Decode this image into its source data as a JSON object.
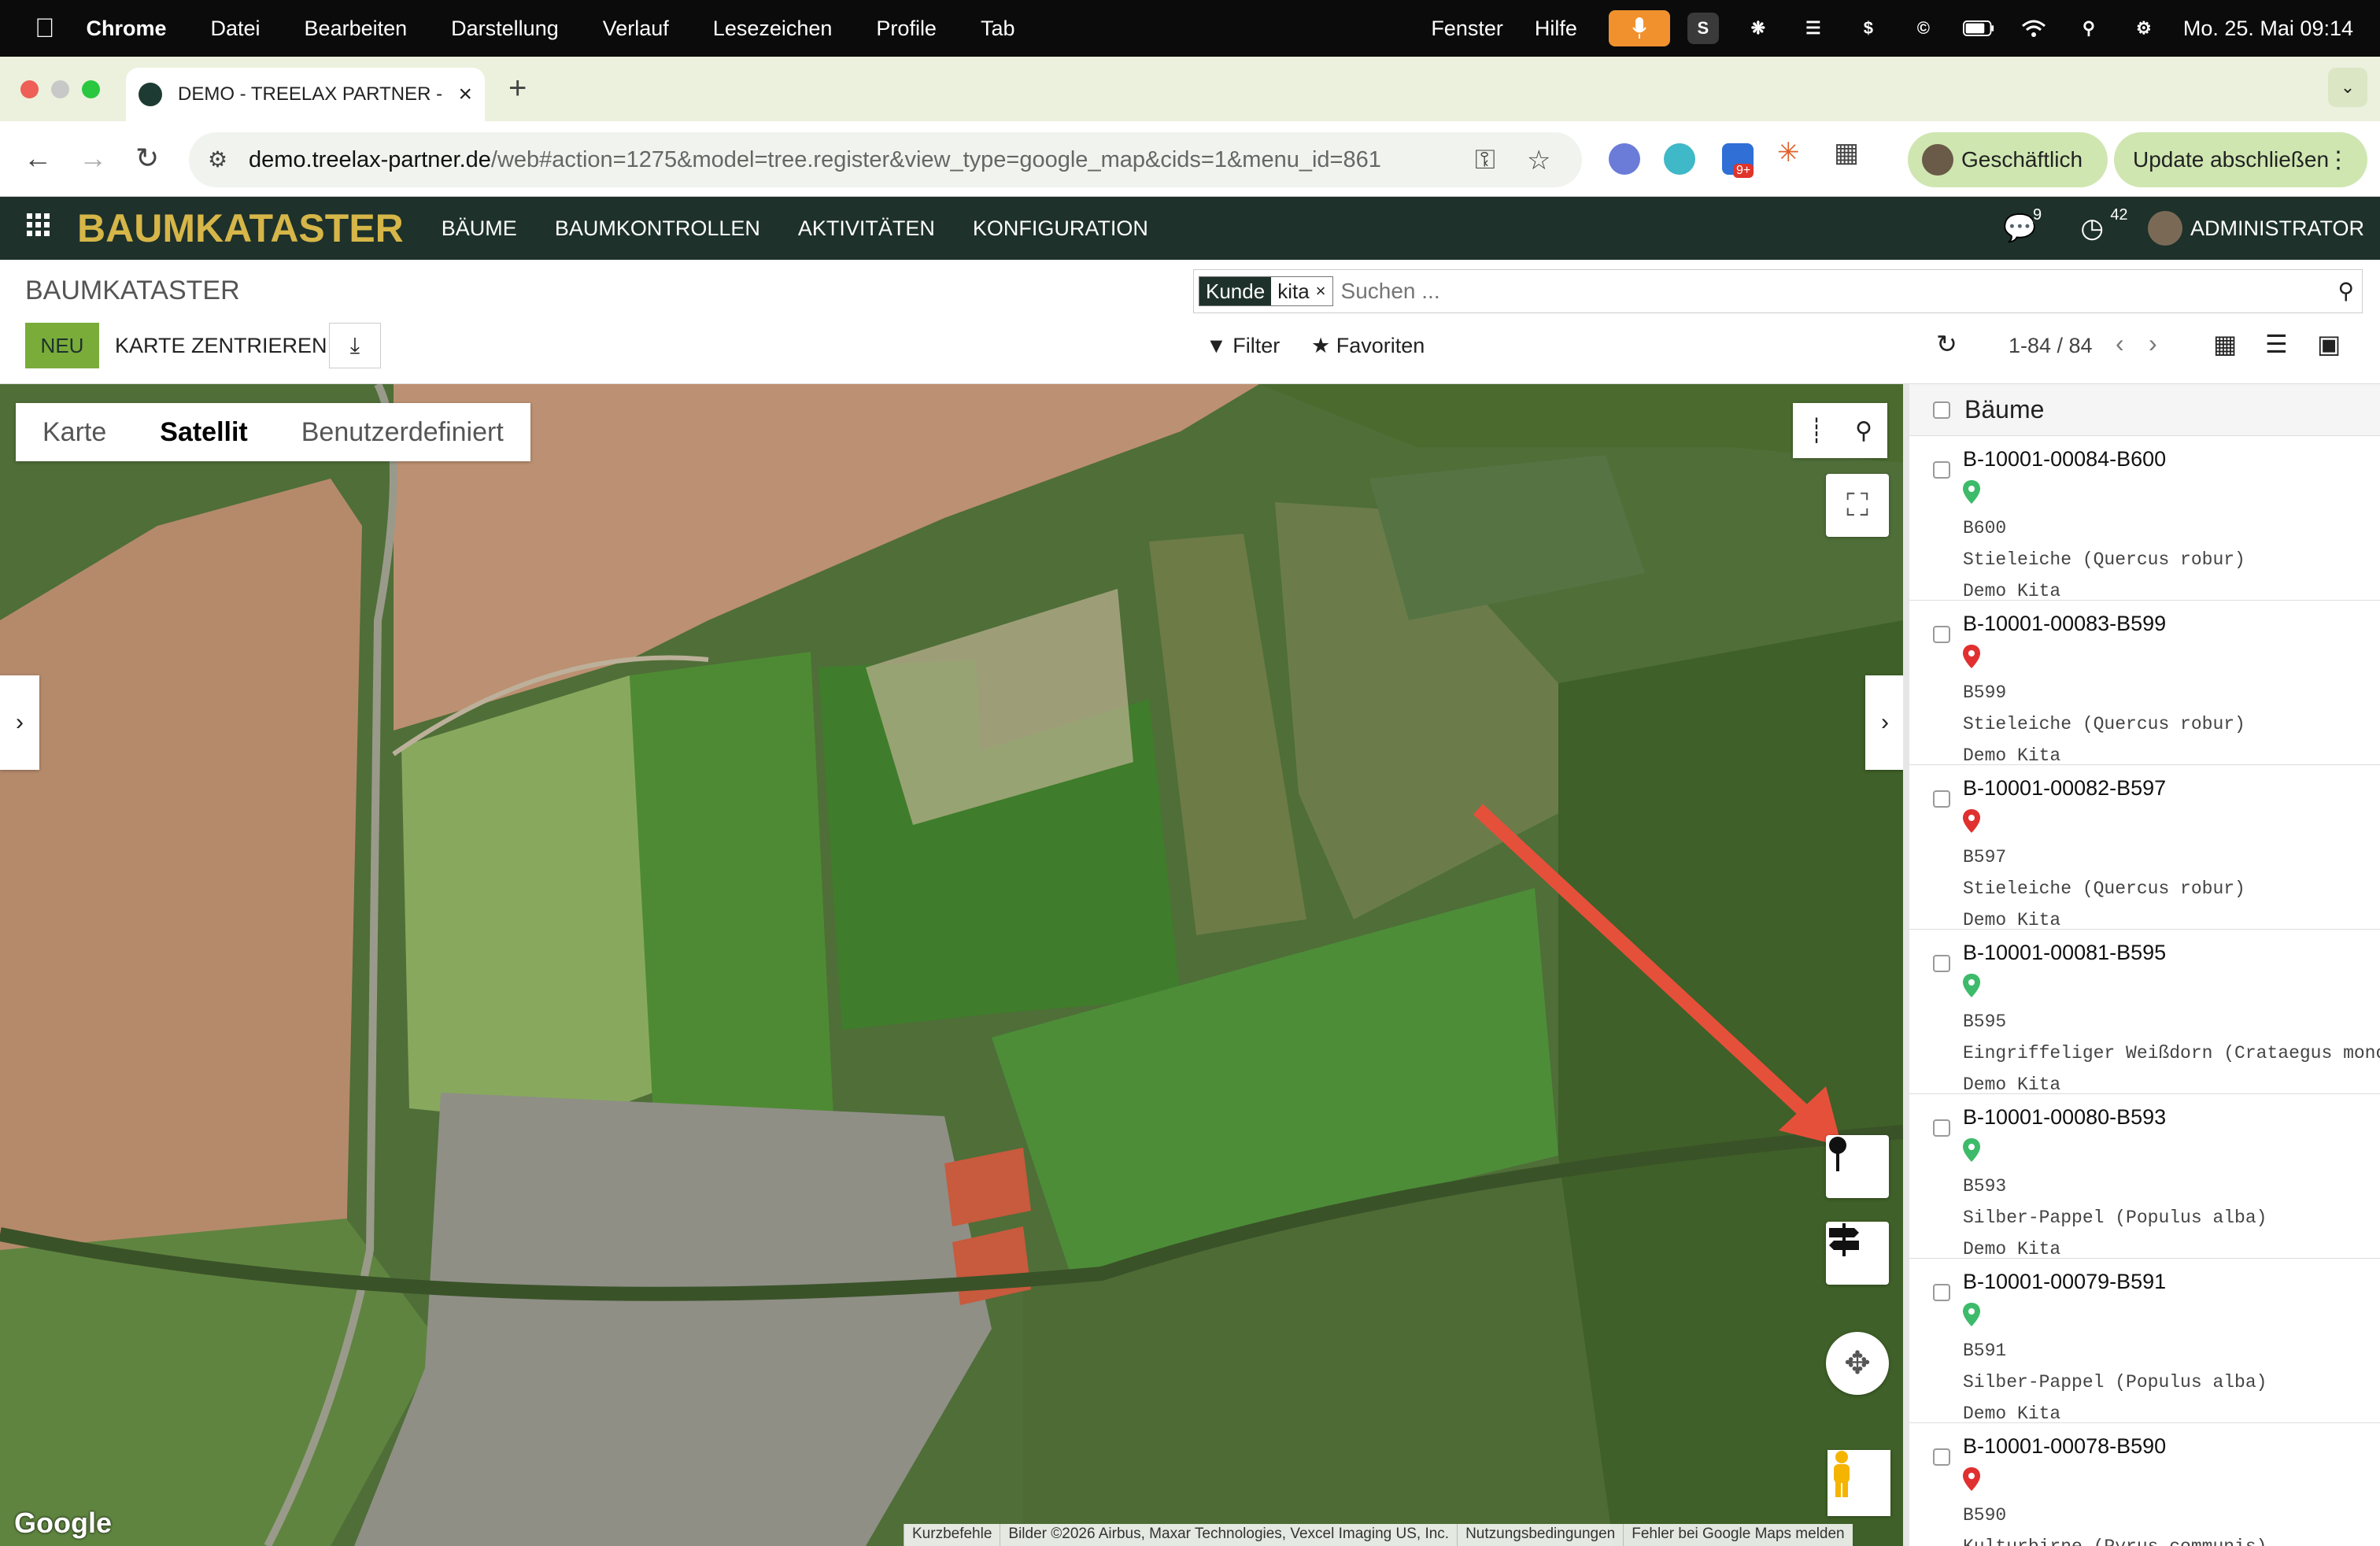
{
  "menubar": {
    "app": "Chrome",
    "items": [
      "Datei",
      "Bearbeiten",
      "Darstellung",
      "Verlauf",
      "Lesezeichen",
      "Profile",
      "Tab"
    ],
    "right_items": [
      "Fenster",
      "Hilfe"
    ],
    "status_letter": "S",
    "datetime": "Mo. 25. Mai  09:14"
  },
  "browser": {
    "tab_title": "DEMO - TREELAX PARTNER -",
    "url_host": "demo.treelax-partner.de",
    "url_path": "/web#action=1275&model=tree.register&view_type=google_map&cids=1&menu_id=861",
    "extension_badge": "9+",
    "profile_label": "Geschäftlich",
    "update_label": "Update abschließen"
  },
  "app": {
    "brand": "BAUMKATASTER",
    "menu": [
      "BÄUME",
      "BAUMKONTROLLEN",
      "AKTIVITÄTEN",
      "KONFIGURATION"
    ],
    "messages_count": "9",
    "activities_count": "42",
    "user": "ADMINISTRATOR",
    "brand_color": "#d6b648",
    "bar_color": "#1e312b"
  },
  "control": {
    "page_title": "BAUMKATASTER",
    "facet_key": "Kunde",
    "facet_value": "kita",
    "search_placeholder": "Suchen ...",
    "new_label": "NEU",
    "center_label": "KARTE ZENTRIEREN",
    "filter_label": "Filter",
    "favorites_label": "Favoriten",
    "pager": "1-84 / 84"
  },
  "map": {
    "types": [
      "Karte",
      "Satellit",
      "Benutzerdefiniert"
    ],
    "active_type": "Satellit",
    "logo": "Google",
    "attribution": [
      "Kurzbefehle",
      "Bilder ©2026 Airbus, Maxar Technologies, Vexcel Imaging US, Inc.",
      "Nutzungsbedingungen",
      "Fehler bei Google Maps melden"
    ],
    "annotation_arrow_color": "#e5503a"
  },
  "list": {
    "header": "Bäume",
    "items": [
      {
        "code": "B-10001-00084-B600",
        "pin": "#3dbb6a",
        "short": "B600",
        "species": "Stieleiche (Quercus robur)",
        "customer": "Demo Kita"
      },
      {
        "code": "B-10001-00083-B599",
        "pin": "#e03030",
        "short": "B599",
        "species": "Stieleiche (Quercus robur)",
        "customer": "Demo Kita"
      },
      {
        "code": "B-10001-00082-B597",
        "pin": "#e03030",
        "short": "B597",
        "species": "Stieleiche (Quercus robur)",
        "customer": "Demo Kita"
      },
      {
        "code": "B-10001-00081-B595",
        "pin": "#3dbb6a",
        "short": "B595",
        "species": "Eingriffeliger Weißdorn (Crataegus monog",
        "customer": "Demo Kita"
      },
      {
        "code": "B-10001-00080-B593",
        "pin": "#3dbb6a",
        "short": "B593",
        "species": "Silber-Pappel (Populus alba)",
        "customer": "Demo Kita"
      },
      {
        "code": "B-10001-00079-B591",
        "pin": "#3dbb6a",
        "short": "B591",
        "species": "Silber-Pappel (Populus alba)",
        "customer": "Demo Kita"
      },
      {
        "code": "B-10001-00078-B590",
        "pin": "#e03030",
        "short": "B590",
        "species": "Kulturbirne (Pyrus communis)",
        "customer": ""
      }
    ]
  }
}
